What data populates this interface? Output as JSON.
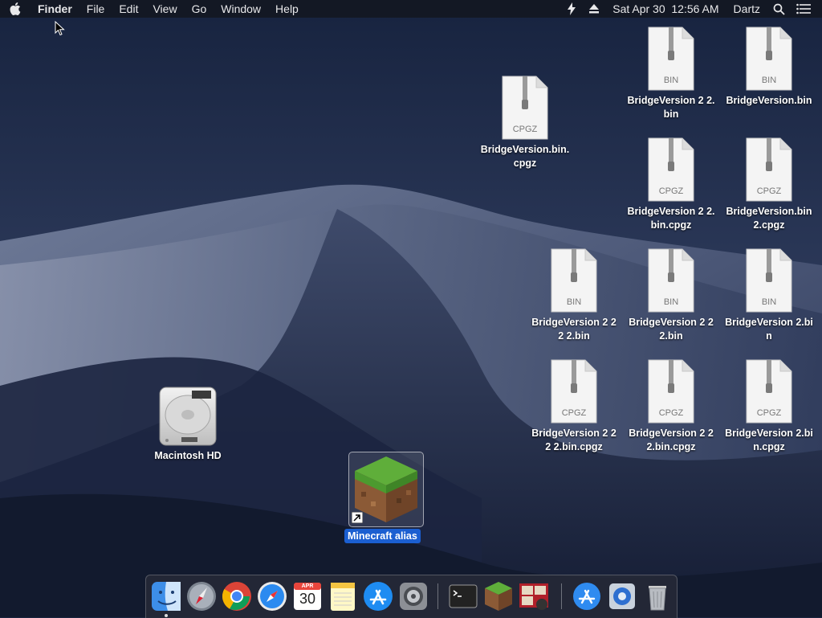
{
  "menubar": {
    "app_name": "Finder",
    "menus": [
      "File",
      "Edit",
      "View",
      "Go",
      "Window",
      "Help"
    ],
    "clock": "Sat Apr 30  12:56 AM",
    "user": "Dartz"
  },
  "desktop": {
    "files": [
      {
        "name": "BridgeVersion.bin.cpgz",
        "type": "CPGZ"
      },
      {
        "name": "BridgeVersion 2 2.bin",
        "type": "BIN"
      },
      {
        "name": "BridgeVersion.bin",
        "type": "BIN"
      },
      {
        "name": "BridgeVersion 2 2.bin.cpgz",
        "type": "CPGZ"
      },
      {
        "name": "BridgeVersion.bin 2.cpgz",
        "type": "CPGZ"
      },
      {
        "name": "BridgeVersion 2 2 2 2.bin",
        "type": "BIN"
      },
      {
        "name": "BridgeVersion 2 2 2.bin",
        "type": "BIN"
      },
      {
        "name": "BridgeVersion 2.bin",
        "type": "BIN"
      },
      {
        "name": "BridgeVersion 2 2 2 2.bin.cpgz",
        "type": "CPGZ"
      },
      {
        "name": "BridgeVersion 2 2 2.bin.cpgz",
        "type": "CPGZ"
      },
      {
        "name": "BridgeVersion 2.bin.cpgz",
        "type": "CPGZ"
      }
    ],
    "drive": {
      "name": "Macintosh HD"
    },
    "alias": {
      "name": "Minecraft alias"
    }
  },
  "dock": {
    "calendar": {
      "month": "APR",
      "day": "30"
    },
    "apps": [
      "finder",
      "launchpad",
      "chrome",
      "safari",
      "calendar",
      "notes",
      "app-store",
      "system-preferences",
      "terminal",
      "minecraft",
      "photo-booth",
      "app-store-2",
      "utility",
      "trash"
    ]
  },
  "colors": {
    "menubar": "#14182a",
    "selection": "#1b5fd1",
    "wallpaper_sky": "#1f2c4a"
  }
}
